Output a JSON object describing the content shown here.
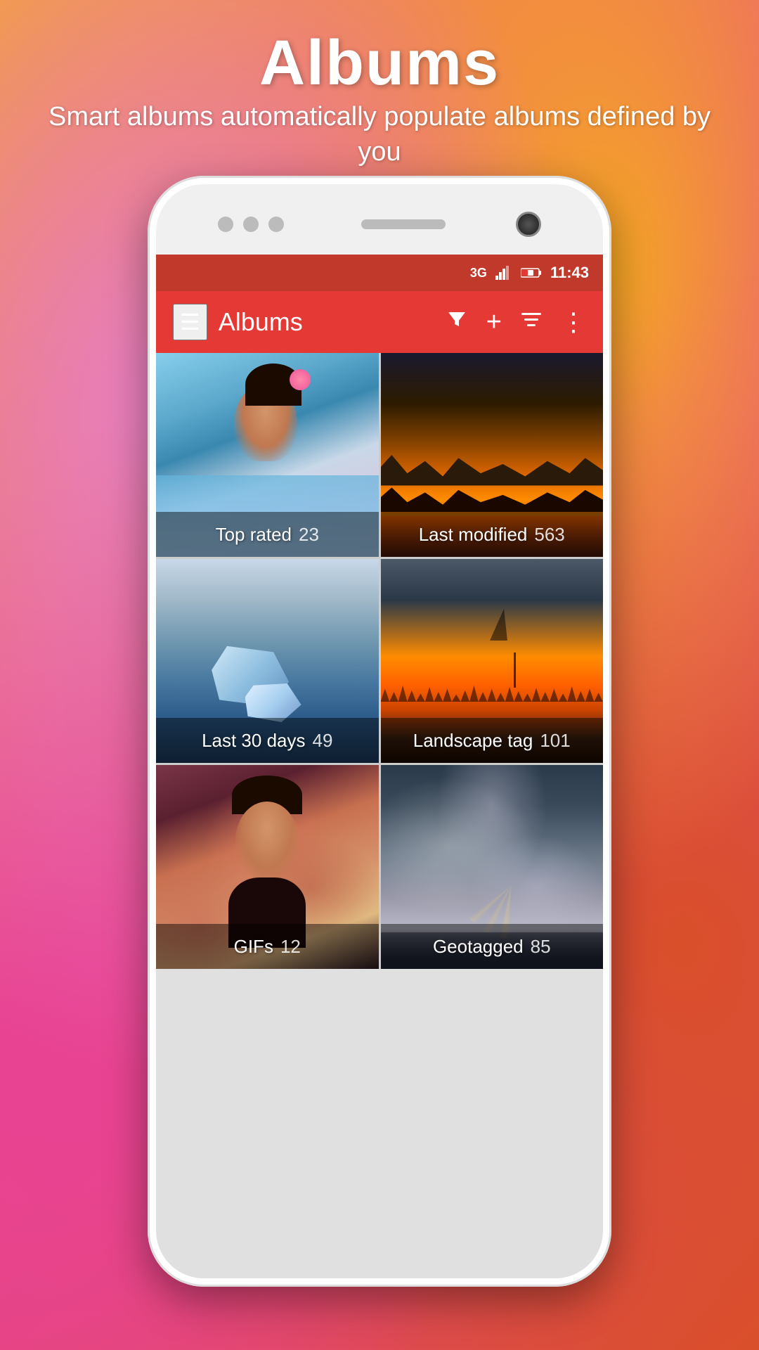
{
  "page": {
    "title": "Albums",
    "subtitle": "Smart albums automatically populate albums defined by you"
  },
  "status_bar": {
    "network": "3G",
    "time": "11:43",
    "signal_icon": "▲",
    "battery_icon": "🔋"
  },
  "toolbar": {
    "title": "Albums",
    "hamburger_icon": "☰",
    "filter_icon": "▼",
    "add_icon": "+",
    "sort_icon": "≡",
    "more_icon": "⋮"
  },
  "albums": [
    {
      "name": "Top rated",
      "count": "23",
      "style": "top-rated"
    },
    {
      "name": "Last modified",
      "count": "563",
      "style": "last-modified"
    },
    {
      "name": "Last 30 days",
      "count": "49",
      "style": "last-30"
    },
    {
      "name": "Landscape tag",
      "count": "101",
      "style": "landscape"
    },
    {
      "name": "GIFs",
      "count": "12",
      "style": "gifs"
    },
    {
      "name": "Geotagged",
      "count": "85",
      "style": "geotagged"
    }
  ],
  "colors": {
    "toolbar_bg": "#e53935",
    "status_bar_bg": "#c0392b",
    "accent": "#e53935"
  }
}
